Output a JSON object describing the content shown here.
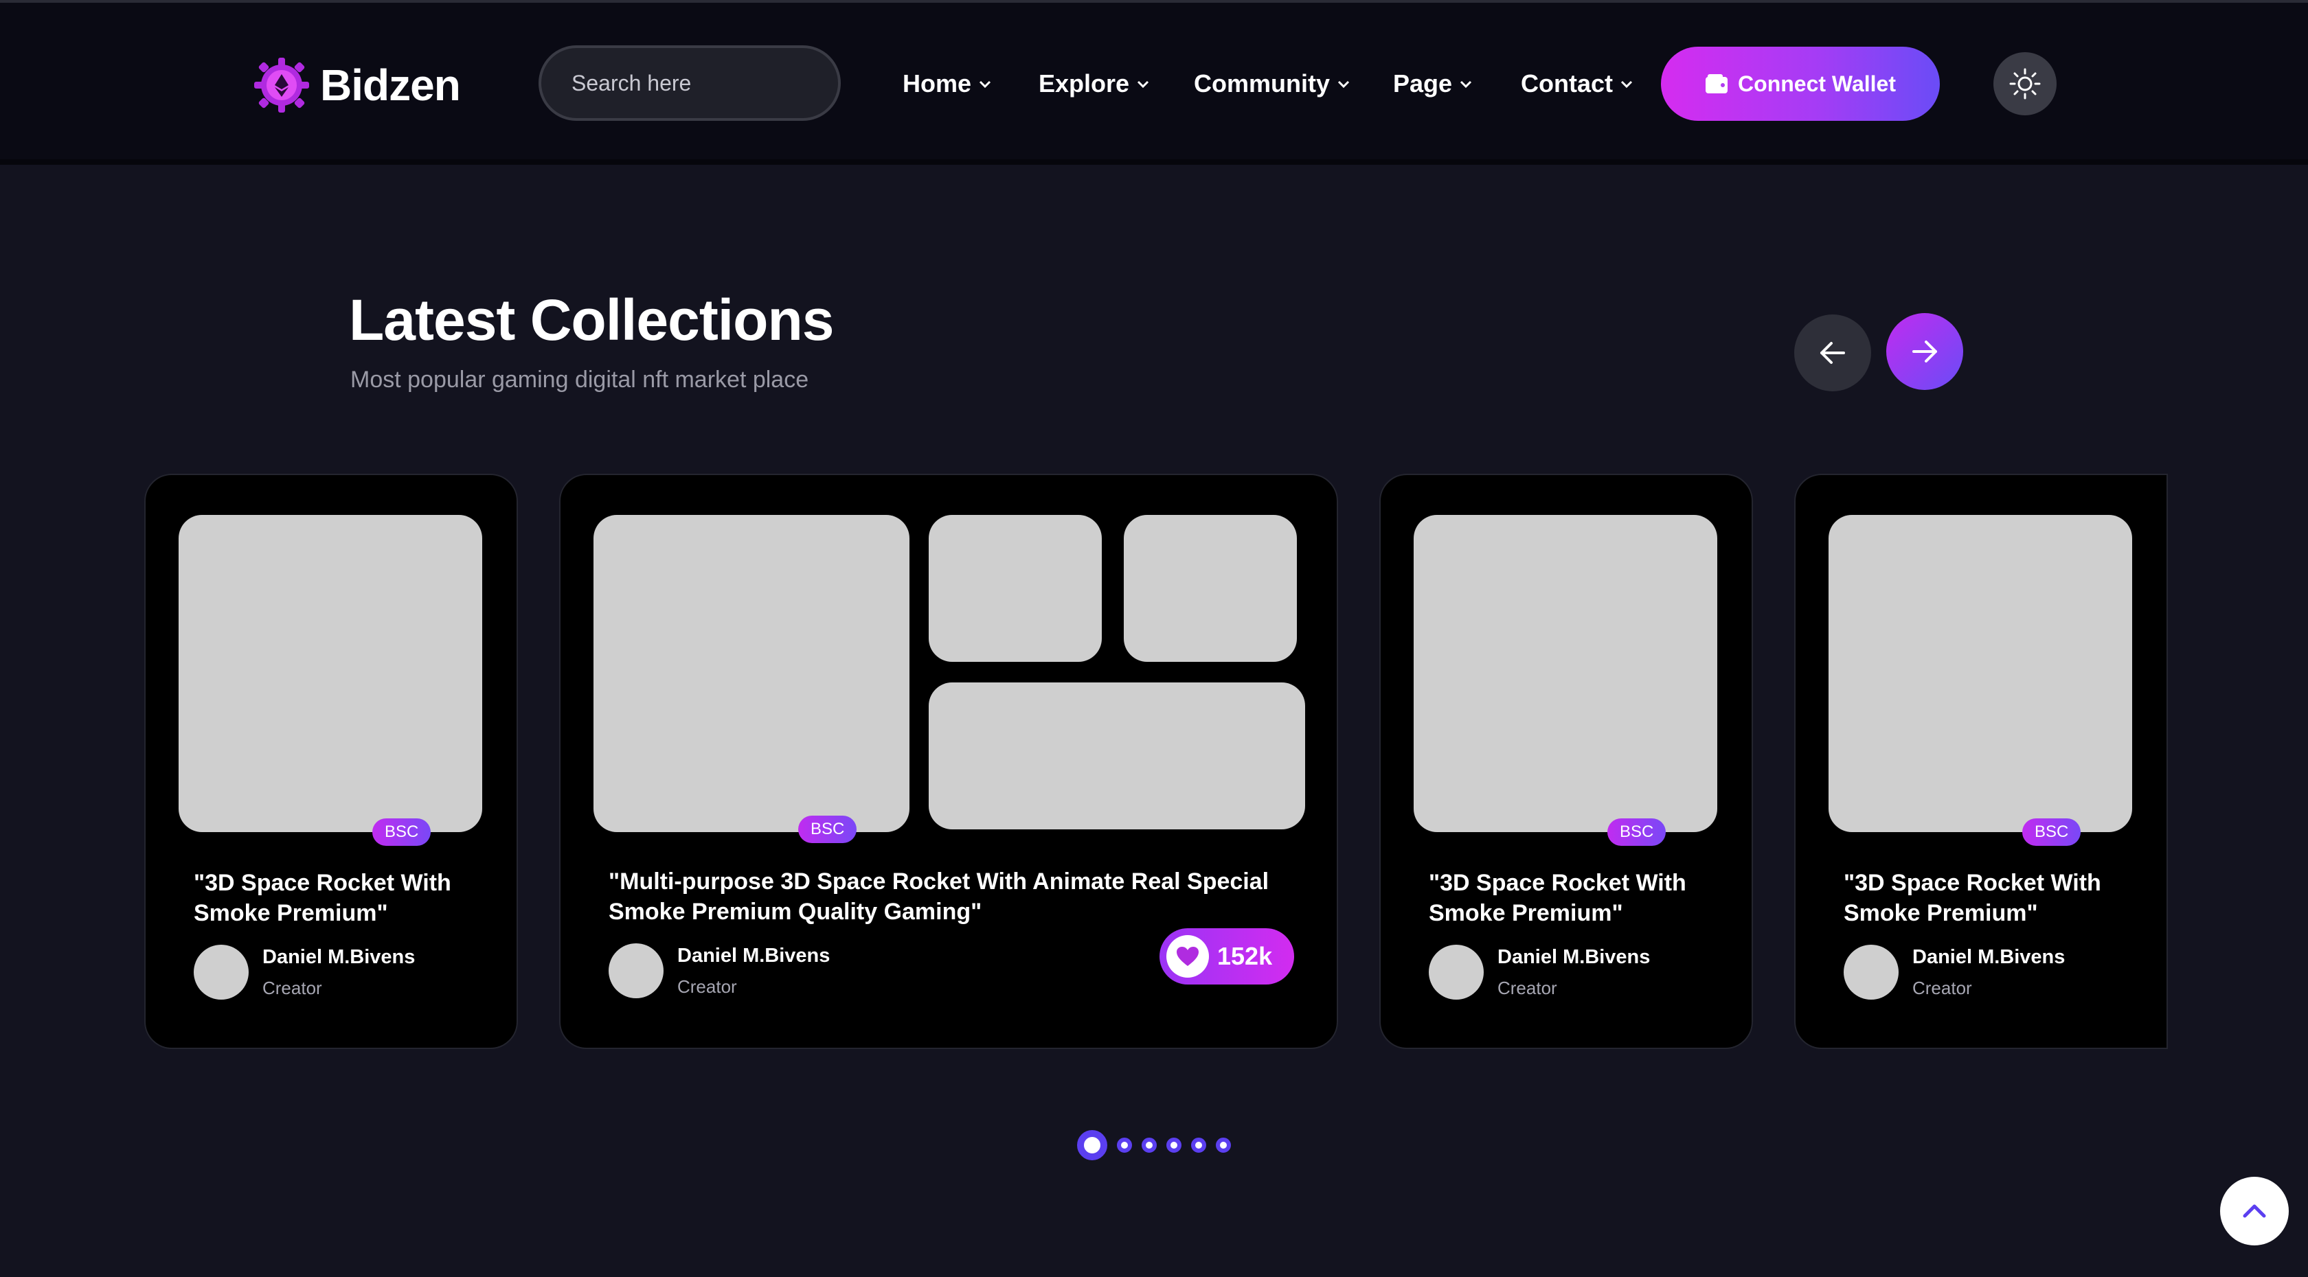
{
  "header": {
    "brand": "Bidzen",
    "logo_icon": "ethereum-gear-logo",
    "search": {
      "placeholder": "Search here",
      "value": "",
      "icon": "search-icon"
    },
    "nav": [
      {
        "label": "Home",
        "icon": "chevron-down-icon"
      },
      {
        "label": "Explore",
        "icon": "chevron-down-icon"
      },
      {
        "label": "Community",
        "icon": "chevron-down-icon"
      },
      {
        "label": "Page",
        "icon": "chevron-down-icon"
      },
      {
        "label": "Contact",
        "icon": "chevron-down-icon"
      }
    ],
    "wallet_button": {
      "label": "Connect Wallet",
      "icon": "wallet-icon"
    },
    "theme_toggle": {
      "icon": "sun-icon"
    }
  },
  "section": {
    "title": "Latest Collections",
    "subtitle": "Most popular gaming digital nft market place",
    "prev_icon": "arrow-left-icon",
    "next_icon": "arrow-right-icon"
  },
  "cards": [
    {
      "badge": "BSC",
      "title": "\"3D Space Rocket With Smoke Premium\"",
      "creator": "Daniel M.Bivens",
      "role": "Creator"
    },
    {
      "badge": "BSC",
      "title": "\"Multi-purpose 3D Space Rocket With Animate Real Special Smoke Premium Quality Gaming\"",
      "creator": "Daniel M.Bivens",
      "role": "Creator",
      "likes": "152k",
      "likes_icon": "heart-icon"
    },
    {
      "badge": "BSC",
      "title": "\"3D Space Rocket With Smoke Premium\"",
      "creator": "Daniel M.Bivens",
      "role": "Creator"
    },
    {
      "badge": "BSC",
      "title": "\"3D Space Rocket With Smoke Premium\"",
      "creator": "Daniel M.Bivens",
      "role": "Creator"
    }
  ],
  "pagination": {
    "count": 6,
    "active": 1
  },
  "scroll_top_icon": "chevron-up-icon",
  "colors": {
    "accent_start": "#d52cf0",
    "accent_end": "#6a4cf6",
    "background": "#13131f",
    "card": "#000000"
  }
}
